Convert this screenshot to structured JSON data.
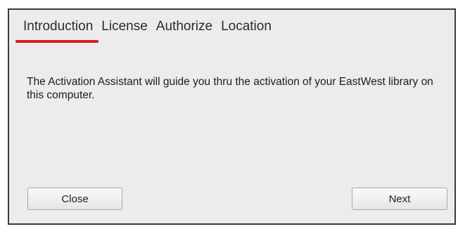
{
  "tabs": [
    {
      "label": "Introduction",
      "active": true
    },
    {
      "label": "License",
      "active": false
    },
    {
      "label": "Authorize",
      "active": false
    },
    {
      "label": "Location",
      "active": false
    }
  ],
  "body": {
    "message": "The Activation Assistant will guide you thru the activation of your EastWest library on this computer."
  },
  "buttons": {
    "close_label": "Close",
    "next_label": "Next"
  },
  "colors": {
    "active_tab_underline": "#e3171a",
    "window_background": "#ececec",
    "window_border": "#3b3b3b"
  }
}
